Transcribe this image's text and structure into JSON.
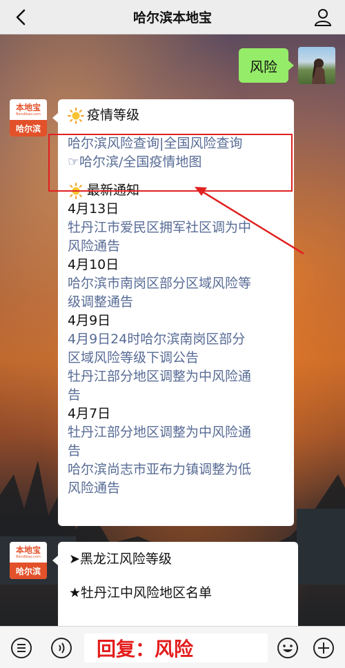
{
  "header": {
    "title": "哈尔滨本地宝"
  },
  "me": {
    "message": "风险"
  },
  "bot": {
    "logo_text": "本地宝",
    "logo_sub": "Bendibao.com",
    "city": "哈尔滨"
  },
  "card1": {
    "section1_title": "疫情等级",
    "links": [
      "哈尔滨风险查询|全国风险查询",
      "☞哈尔滨/全国疫情地图"
    ],
    "section2_title": "最新通知",
    "lines": [
      {
        "text": "4月13日",
        "link": false
      },
      {
        "text": "牡丹江市爱民区拥军社区调为中",
        "link": true
      },
      {
        "text": "风险通告",
        "link": true
      },
      {
        "text": "4月10日",
        "link": false
      },
      {
        "text": "哈尔滨市南岗区部分区域风险等",
        "link": true
      },
      {
        "text": "级调整通告",
        "link": true
      },
      {
        "text": "4月9日",
        "link": false
      },
      {
        "text": "4月9日24时哈尔滨南岗区部分",
        "link": true
      },
      {
        "text": "区域风险等级下调公告",
        "link": true
      },
      {
        "text": "牡丹江部分地区调整为中风险通",
        "link": true
      },
      {
        "text": "告",
        "link": true
      },
      {
        "text": "4月7日",
        "link": false
      },
      {
        "text": "牡丹江部分地区调整为中风险通",
        "link": true
      },
      {
        "text": "告",
        "link": true
      },
      {
        "text": "哈尔滨尚志市亚布力镇调整为低",
        "link": true
      },
      {
        "text": "风险通告",
        "link": true
      }
    ]
  },
  "card2": {
    "line1": "➤黑龙江风险等级",
    "line2": "★牡丹江中风险地区名单"
  },
  "input": {
    "text": "回复：风险"
  },
  "colors": {
    "link": "#576b95",
    "highlight": "#e02020",
    "my_bubble": "#95ec69",
    "input_text": "#e31c1c"
  }
}
